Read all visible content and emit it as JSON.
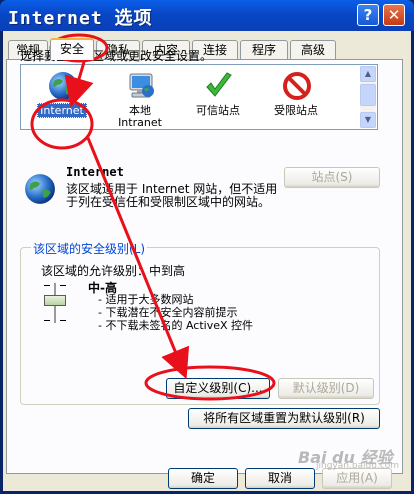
{
  "window": {
    "title": "Internet 选项",
    "help_label": "?",
    "close_label": "✕"
  },
  "tabs": [
    {
      "label": "常规"
    },
    {
      "label": "安全"
    },
    {
      "label": "隐私"
    },
    {
      "label": "内容"
    },
    {
      "label": "连接"
    },
    {
      "label": "程序"
    },
    {
      "label": "高级"
    }
  ],
  "security": {
    "instruction": "选择要查看的区域或更改安全设置。",
    "zones": [
      {
        "label": "Internet",
        "icon": "globe-icon",
        "selected": true
      },
      {
        "label": "本地\nIntranet",
        "icon": "computer-globe-icon"
      },
      {
        "label": "可信站点",
        "icon": "checkmark-icon"
      },
      {
        "label": "受限站点",
        "icon": "no-entry-icon"
      }
    ],
    "sites_button": "站点(S)",
    "selected_zone_title": "Internet",
    "selected_zone_desc": "该区域适用于 Internet 网站，但不适用于列在受信任和受限制区域中的网站。",
    "level_group_title": "该区域的安全级别(L)",
    "allowed_levels": "该区域的允许级别：中到高",
    "level_name": "中-高",
    "level_bullets": [
      "- 适用于大多数网站",
      "- 下载潜在不安全内容前提示",
      "- 不下载未签名的 ActiveX 控件"
    ],
    "custom_level_button": "自定义级别(C)...",
    "default_level_button": "默认级别(D)",
    "reset_all_button": "将所有区域重置为默认级别(R)"
  },
  "footer": {
    "ok_button": "确定",
    "cancel_button": "取消",
    "apply_button": "应用(A)"
  },
  "watermark": {
    "text": "Bai du 经验",
    "sub": "jingyan.baidu.com"
  },
  "colors": {
    "annotation": "#e8101a",
    "title_bar": "#0b5fe8",
    "selection": "#316ac5",
    "link_blue": "#0046d5"
  }
}
